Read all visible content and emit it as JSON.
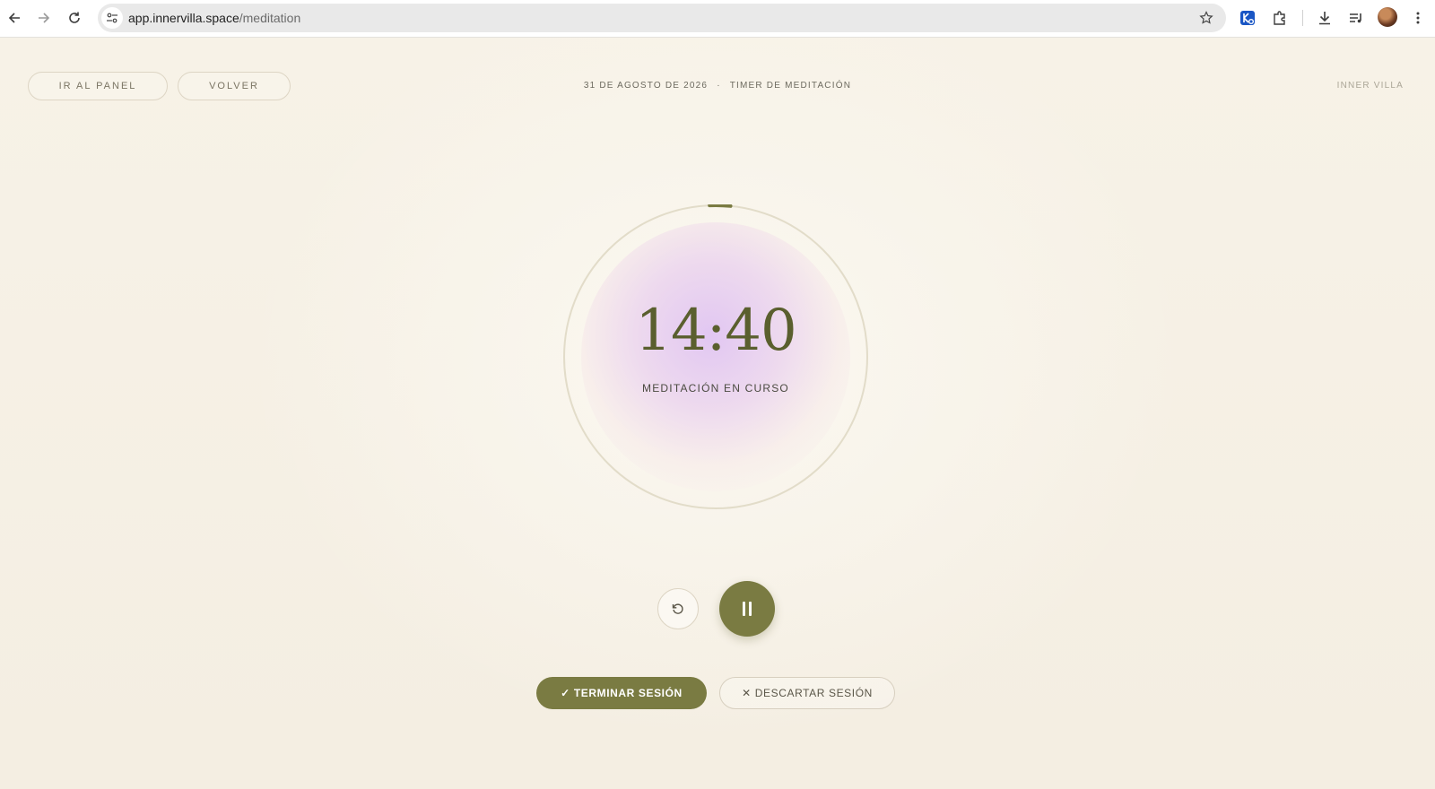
{
  "browser": {
    "url_domain": "app.innervilla.space",
    "url_path": "/meditation",
    "icons": [
      "back-arrow-icon",
      "forward-arrow-icon",
      "reload-icon",
      "site-info-icon",
      "bookmark-star-icon",
      "extension-icon",
      "puzzle-icon",
      "download-icon",
      "media-queue-icon",
      "avatar",
      "more-vert-icon"
    ]
  },
  "header": {
    "panel_label": "IR AL PANEL",
    "back_label": "VOLVER",
    "date": "31 DE AGOSTO DE 2026",
    "separator": "·",
    "section": "TIMER DE MEDITACIÓN",
    "brand": "INNER VILLA"
  },
  "timer": {
    "time": "14:40",
    "status": "MEDITACIÓN EN CURSO",
    "progress_fraction": 0.022,
    "accent_color": "#7a7b42",
    "glow_color": "#e0c4f2"
  },
  "controls": {
    "reset_icon": "reset-icon",
    "pause_icon": "pause-icon"
  },
  "actions": {
    "end_check": "✓",
    "end_label": "TERMINAR SESIÓN",
    "discard_x": "✕",
    "discard_label": "DESCARTAR SESIÓN"
  }
}
